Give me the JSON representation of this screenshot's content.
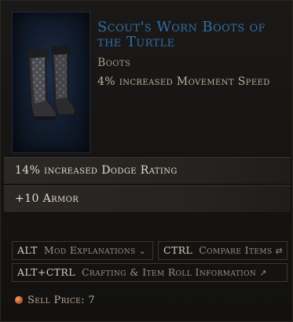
{
  "item": {
    "name": "Scout's Worn Boots of the Turtle",
    "type": "Boots",
    "implicit": "4% increased Movement Speed",
    "image_icon": "boots-icon"
  },
  "affixes": [
    "14% increased Dodge Rating",
    "+10 Armor"
  ],
  "buttons": {
    "mod": {
      "key": "ALT",
      "label": "Mod Explanations",
      "icon": "chevron-down-icon"
    },
    "compare": {
      "key": "CTRL",
      "label": "Compare Items",
      "icon": "compare-icon"
    },
    "crafting": {
      "key": "ALT+CTRL",
      "label": "Crafting & Item Roll Information",
      "icon": "arrow-out-icon"
    }
  },
  "sell": {
    "label": "Sell Price: 7",
    "icon": "gold-coin-icon"
  },
  "colors": {
    "name": "#2f6ea8",
    "text": "#e2d8c8",
    "muted": "#a49a8c"
  }
}
